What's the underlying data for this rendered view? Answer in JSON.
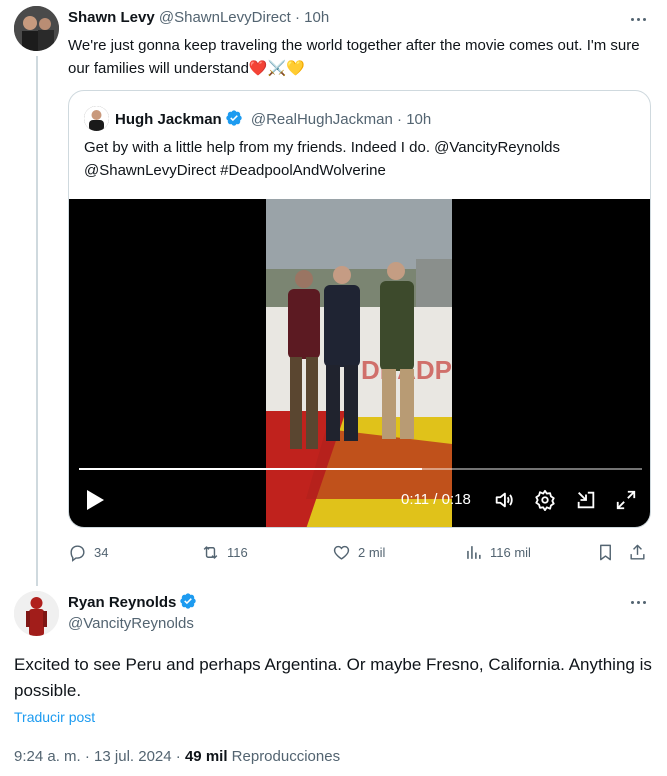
{
  "thread_tweet": {
    "author_name": "Shawn Levy",
    "author_handle": "@ShawnLevyDirect",
    "separator": "·",
    "time_ago": "10h",
    "text": "We're just gonna keep traveling the world together after the movie comes out. I'm sure our families will understand❤️⚔️💛",
    "quote": {
      "author_name": "Hugh Jackman",
      "author_handle": "@RealHughJackman",
      "separator": "·",
      "time_ago": "10h",
      "text": "Get by with a little help from my friends. Indeed I do. @VancityReynolds @ShawnLevyDirect #DeadpoolAndWolverine",
      "video": {
        "current_time": "0:11",
        "time_divider": "/",
        "duration": "0:18",
        "progress": 0.61
      }
    },
    "actions": {
      "replies": "34",
      "reposts": "116",
      "likes": "2 mil",
      "views": "116 mil"
    }
  },
  "main_tweet": {
    "author_name": "Ryan Reynolds",
    "author_handle": "@VancityReynolds",
    "text": "Excited to see Peru and perhaps Argentina. Or maybe Fresno, California. Anything is possible.",
    "translate_label": "Traducir post",
    "time": "9:24 a. m.",
    "date": "13 jul. 2024",
    "separator": "·",
    "views_count": "49 mil",
    "views_label": "Reproducciones"
  },
  "colors": {
    "accent": "#1d9bf0",
    "muted": "#536471",
    "text": "#0f1419",
    "border": "#cfd9de"
  },
  "icons": [
    "more-icon",
    "verified-badge-icon",
    "play-icon",
    "volume-icon",
    "settings-icon",
    "dock-icon",
    "fullscreen-icon",
    "reply-icon",
    "repost-icon",
    "like-icon",
    "views-icon",
    "bookmark-icon",
    "share-icon"
  ]
}
